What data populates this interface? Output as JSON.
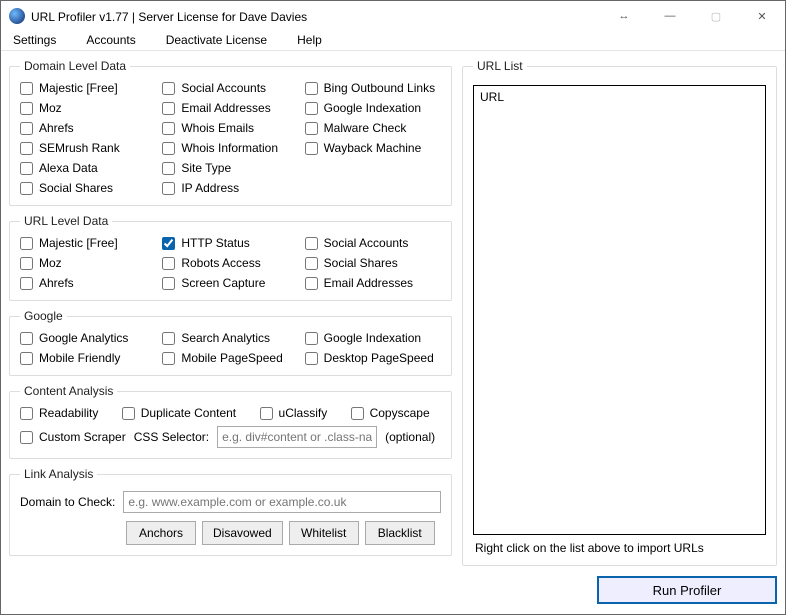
{
  "window": {
    "title": "URL Profiler v1.77 | Server License for Dave Davies"
  },
  "menu": {
    "settings": "Settings",
    "accounts": "Accounts",
    "deactivate": "Deactivate License",
    "help": "Help"
  },
  "domain_level": {
    "legend": "Domain Level Data",
    "col1": [
      "Majestic [Free]",
      "Moz",
      "Ahrefs",
      "SEMrush Rank",
      "Alexa Data",
      "Social Shares"
    ],
    "col2": [
      "Social Accounts",
      "Email Addresses",
      "Whois Emails",
      "Whois Information",
      "Site Type",
      "IP Address"
    ],
    "col3": [
      "Bing Outbound Links",
      "Google Indexation",
      "Malware Check",
      "Wayback Machine"
    ]
  },
  "url_level": {
    "legend": "URL Level Data",
    "col1": [
      "Majestic [Free]",
      "Moz",
      "Ahrefs"
    ],
    "col2": [
      "HTTP Status",
      "Robots Access",
      "Screen Capture"
    ],
    "col2_checked": [
      true,
      false,
      false
    ],
    "col3": [
      "Social Accounts",
      "Social Shares",
      "Email Addresses"
    ]
  },
  "google": {
    "legend": "Google",
    "col1": [
      "Google Analytics",
      "Mobile Friendly"
    ],
    "col2": [
      "Search Analytics",
      "Mobile PageSpeed"
    ],
    "col3": [
      "Google Indexation",
      "Desktop PageSpeed"
    ]
  },
  "content_analysis": {
    "legend": "Content Analysis",
    "row1": [
      "Readability",
      "Duplicate Content",
      "uClassify",
      "Copyscape"
    ],
    "custom_scraper": "Custom Scraper",
    "css_selector_label": "CSS Selector:",
    "css_selector_placeholder": "e.g. div#content or .class-na",
    "optional": "(optional)"
  },
  "link_analysis": {
    "legend": "Link Analysis",
    "domain_label": "Domain to Check:",
    "domain_placeholder": "e.g. www.example.com or example.co.uk",
    "buttons": [
      "Anchors",
      "Disavowed",
      "Whitelist",
      "Blacklist"
    ]
  },
  "url_list": {
    "legend": "URL List",
    "header": "URL",
    "hint": "Right click on the list above to import URLs"
  },
  "run_button": "Run Profiler"
}
